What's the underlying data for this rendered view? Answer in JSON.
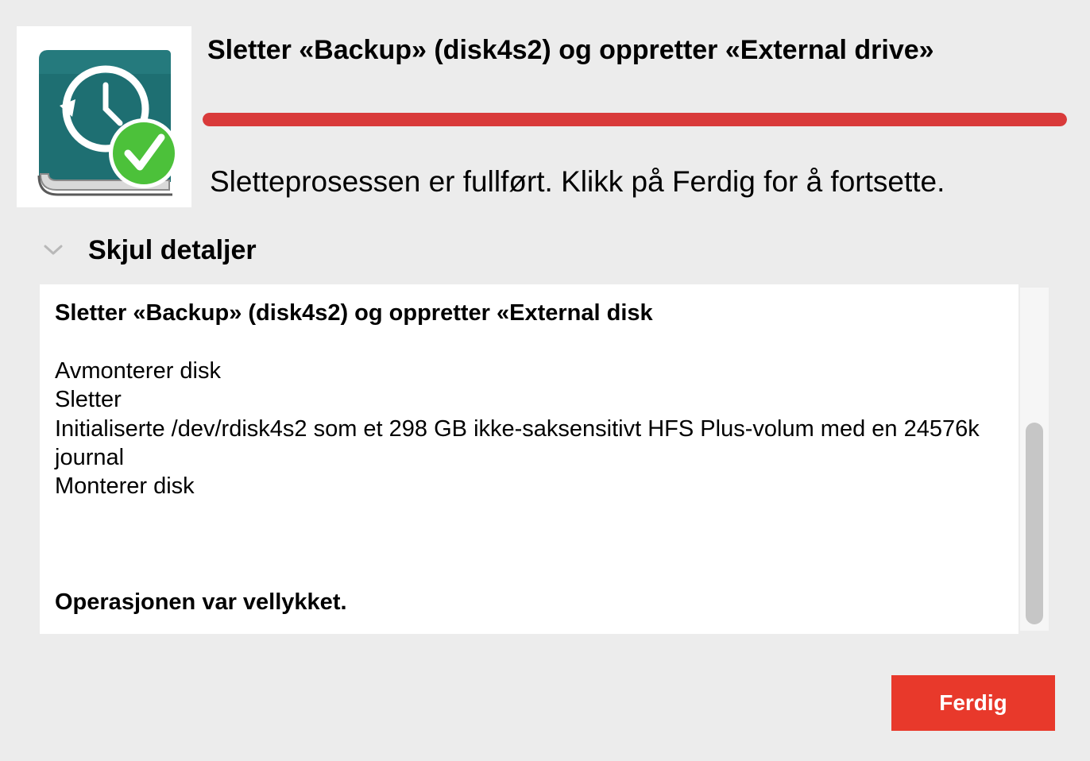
{
  "dialog": {
    "title": "Sletter «Backup» (disk4s2) og oppretter «External drive»",
    "progress": 1.0,
    "status": "Sletteprosessen er fullført. Klikk på Ferdig for å fortsette.",
    "details_toggle_label": "Skjul detaljer",
    "details": {
      "heading": "Sletter «Backup» (disk4s2) og oppretter «External disk",
      "lines": [
        "Avmonterer disk",
        "Sletter",
        "Initialiserte /dev/rdisk4s2 som et 298 GB ikke-saksensitivt HFS Plus-volum med en 24576k journal",
        "Monterer disk"
      ],
      "result": "Operasjonen var vellykket."
    },
    "done_button_label": "Ferdig"
  },
  "icons": {
    "app_icon": "time-machine-drive-with-checkmark-icon",
    "toggle": "chevron-down-icon"
  },
  "colors": {
    "accent": "#e8392b",
    "progress": "#d93a3a",
    "drive_teal": "#1e6f72",
    "check_green": "#4cc13a"
  }
}
